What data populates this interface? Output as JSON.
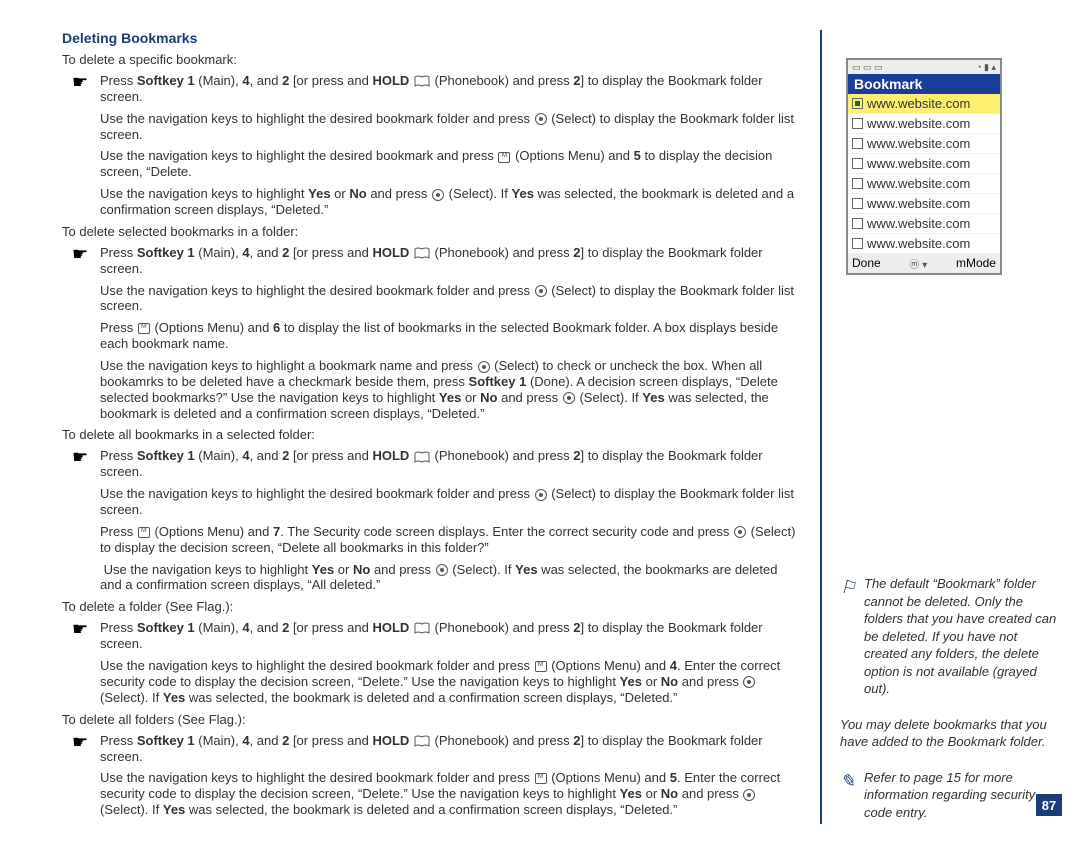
{
  "section_title": "Deleting Bookmarks",
  "leads": {
    "l1": "To delete a specific bookmark:",
    "l2": "To delete selected bookmarks in a folder:",
    "l3": "To delete all bookmarks in a selected folder:",
    "l4": "To delete a folder (See Flag.):",
    "l5": "To delete all folders (See Flag.):"
  },
  "strings": {
    "press": "Press ",
    "softkey1": "Softkey 1",
    "main_42": " (Main), ",
    "four": "4",
    "and": ", and ",
    "two": "2",
    "or_press_hold": " [or press and ",
    "hold": "HOLD",
    "phonebook_press": " (Phonebook) and press ",
    "close_display_folder": "] to display the Bookmark folder screen.",
    "nav_to_folder_select_list": "Use the navigation keys to highlight the desired bookmark folder and press ",
    "select_display_list": " (Select) to display the Bookmark folder list screen.",
    "nav_to_bookmark_options5_delete": "Use the navigation keys to highlight the desired bookmark and press ",
    "options_menu_and": " (Options Menu) and ",
    "five": "5",
    "display_decision_delete": " to display the decision screen, “Delete.",
    "nav_yes_no_select": "Use the navigation keys to highlight ",
    "yes": "Yes",
    "or": " or ",
    "no": "No",
    "and_press": " and press ",
    "select_if_yes_deleted": " (Select). If ",
    "was_selected_bookmark_deleted": " was selected, the bookmark is deleted and a confirmation screen displays, “Deleted.”",
    "six": "6",
    "display_bookmark_list_box": " to display the list of bookmarks in the selected Bookmark folder. A box displays beside each bookmark name.",
    "nav_to_bookmark_name_select_check": "Use the navigation keys to highlight a bookmark name and press ",
    "check_uncheck": " (Select) to check or uncheck the box. When all bookamrks to be deleted have a checkmark beside them, press ",
    "done_decision_delete_selected": " (Done). A decision screen displays, “Delete selected bookmarks?” Use the navigation keys to highlight ",
    "select_if_yes_bm_deleted": " (Select). If ",
    "was_selected_bm_deleted_conf": " was selected, the bookmark is deleted and a confirmation screen displays, “Deleted.”",
    "seven": "7",
    "security_prompt": ". The Security code screen displays. Enter the correct security code and press ",
    "select_display_delete_all": " (Select) to display the decision screen, “Delete all bookmarks in this folder?”",
    "was_selected_bookmarks_deleted_all": " was selected, the bookmarks are deleted and a confirmation screen displays, “All deleted.”",
    "nav_folder_options_and": "Use the navigation keys to highlight the desired bookmark folder and press ",
    "four_enter_security": ". Enter the correct security code to display the decision screen, “Delete.” Use the navigation keys to highlight ",
    "five_enter_security": ". Enter the correct security code to display the decision screen, “Delete.” Use the navigation keys to highlight ",
    "select_if_yes_selected_bm_deleted": " (Select). If ",
    "was_selected_bm_del_conf2": " was selected, the bookmark is deleted and a confirmation screen displays, “Deleted.”"
  },
  "phone": {
    "title": "Bookmark",
    "items": [
      "www.website.com",
      "www.website.com",
      "www.website.com",
      "www.website.com",
      "www.website.com",
      "www.website.com",
      "www.website.com",
      "www.website.com"
    ],
    "left": "Done",
    "right": "mMode"
  },
  "notes": {
    "n1": "The default “Bookmark” folder cannot be deleted. Only the folders that you have created can be deleted. If you have not created any folders, the delete option is not available (grayed out).",
    "n2": "You may delete bookmarks that you have added to the Bookmark folder.",
    "n3": "Refer to page 15 for more information regarding security code entry."
  },
  "page_number": "87"
}
